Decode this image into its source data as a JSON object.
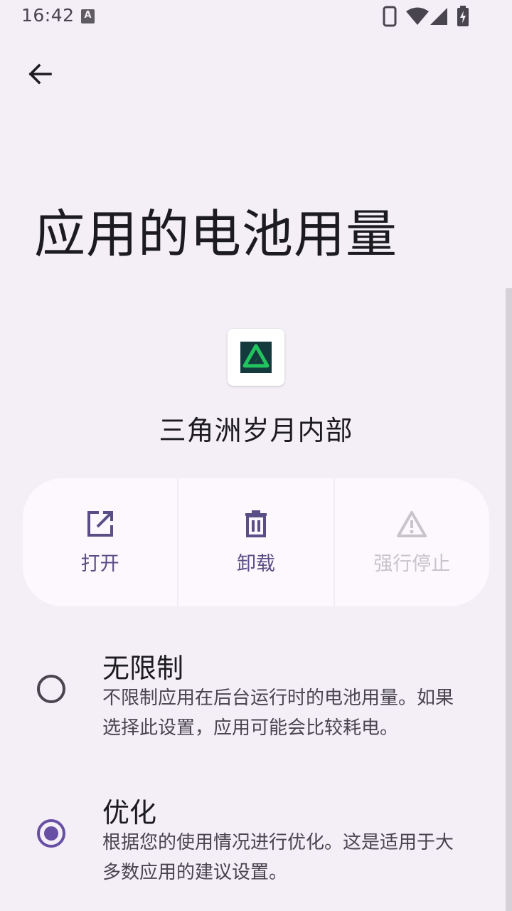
{
  "status_bar": {
    "time": "16:42",
    "notification_letter": "A"
  },
  "page": {
    "title": "应用的电池用量"
  },
  "app": {
    "name": "三角洲岁月内部",
    "icon_colors": {
      "background": "#143a3d",
      "mark": "#22c45e"
    }
  },
  "actions": [
    {
      "label": "打开",
      "icon": "open-in-new-icon",
      "enabled": true
    },
    {
      "label": "卸载",
      "icon": "trash-icon",
      "enabled": true
    },
    {
      "label": "强行停止",
      "icon": "warning-icon",
      "enabled": false
    }
  ],
  "battery_options": [
    {
      "title": "无限制",
      "description": "不限制应用在后台运行时的电池用量。如果选择此设置，应用可能会比较耗电。",
      "selected": false
    },
    {
      "title": "优化",
      "description": "根据您的使用情况进行优化。这是适用于大多数应用的建议设置。",
      "selected": true
    }
  ],
  "colors": {
    "background": "#f4eff6",
    "accent": "#6750a4",
    "action_label": "#5a4e86",
    "disabled": "#c9c4cc"
  }
}
